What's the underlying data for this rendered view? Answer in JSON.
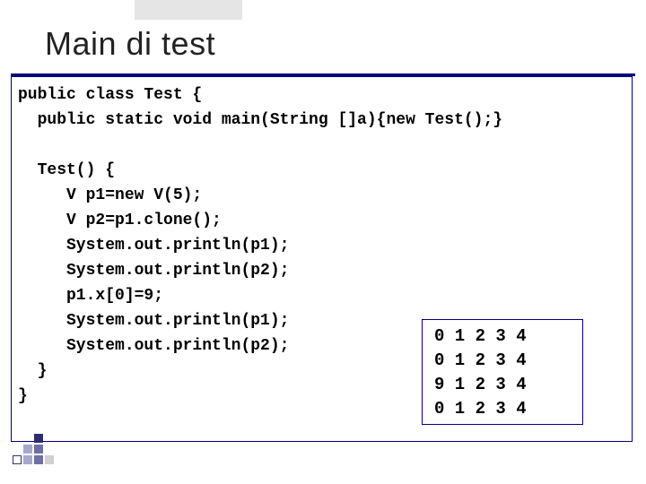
{
  "title": "Main di test",
  "code": "public class Test {\n  public static void main(String []a){new Test();}\n\n  Test() {\n     V p1=new V(5);\n     V p2=p1.clone();\n     System.out.println(p1);\n     System.out.println(p2);\n     p1.x[0]=9;\n     System.out.println(p1);\n     System.out.println(p2);\n  }\n}",
  "output": "0 1 2 3 4\n0 1 2 3 4\n9 1 2 3 4\n0 1 2 3 4",
  "colors": {
    "frame": "#000080",
    "text": "#000000",
    "background": "#ffffff"
  }
}
